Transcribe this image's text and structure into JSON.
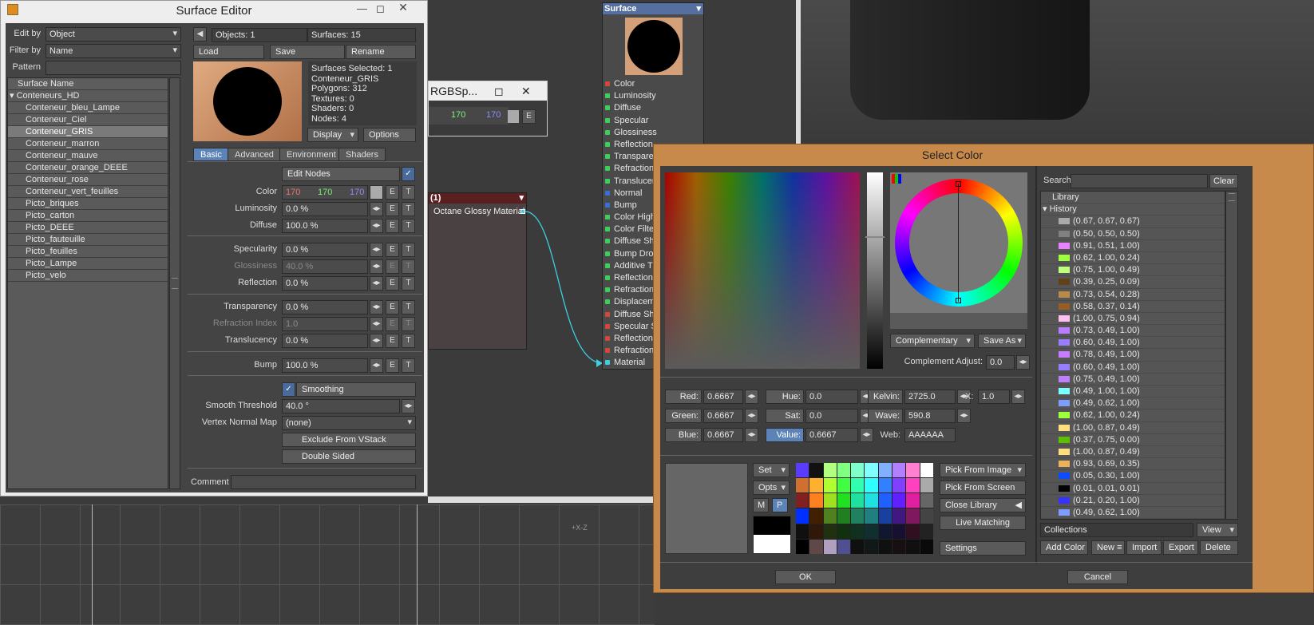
{
  "surface_editor": {
    "title": "Surface Editor",
    "edit_by_label": "Edit by",
    "edit_by_value": "Object",
    "filter_by_label": "Filter by",
    "filter_by_value": "Name",
    "pattern_label": "Pattern",
    "list_header": "Surface Name",
    "group": "Conteneurs_HD",
    "surfaces": [
      "Conteneur_bleu_Lampe",
      "Conteneur_Ciel",
      "Conteneur_GRIS",
      "Conteneur_marron",
      "Conteneur_mauve",
      "Conteneur_orange_DEEE",
      "Conteneur_rose",
      "Conteneur_vert_feuilles",
      "Picto_briques",
      "Picto_carton",
      "Picto_DEEE",
      "Picto_fauteuille",
      "Picto_feuilles",
      "Picto_Lampe",
      "Picto_velo"
    ],
    "selected": "Conteneur_GRIS",
    "objects": "Objects: 1",
    "surfaces_count": "Surfaces: 15",
    "load": "Load",
    "save": "Save",
    "rename": "Rename",
    "info": [
      "Surfaces Selected: 1",
      "Conteneur_GRIS",
      "Polygons: 312",
      "Textures: 0",
      "Shaders: 0",
      "Nodes: 4"
    ],
    "display": "Display",
    "options": "Options",
    "tabs": [
      "Basic",
      "Advanced",
      "Environment",
      "Shaders"
    ],
    "edit_nodes": "Edit Nodes",
    "color_label": "Color",
    "color_r": "170",
    "color_g": "170",
    "color_b": "170",
    "luminosity_label": "Luminosity",
    "luminosity": "0.0 %",
    "diffuse_label": "Diffuse",
    "diffuse": "100.0 %",
    "specularity_label": "Specularity",
    "specularity": "0.0 %",
    "glossiness_label": "Glossiness",
    "glossiness": "40.0 %",
    "reflection_label": "Reflection",
    "reflection": "0.0 %",
    "transparency_label": "Transparency",
    "transparency": "0.0 %",
    "refraction_label": "Refraction Index",
    "refraction": "1.0",
    "translucency_label": "Translucency",
    "translucency": "0.0 %",
    "bump_label": "Bump",
    "bump": "100.0 %",
    "smoothing": "Smoothing",
    "smooth_threshold_label": "Smooth Threshold",
    "smooth_threshold": "40.0 °",
    "vertex_normal_label": "Vertex Normal Map",
    "vertex_normal": "(none)",
    "exclude_vstack": "Exclude From VStack",
    "double_sided": "Double Sided",
    "comment_label": "Comment",
    "e": "E",
    "t": "T"
  },
  "rgb_panel": {
    "title": "RGBSp...",
    "g": "170",
    "b": "170",
    "e": "E"
  },
  "node": {
    "header": "(1)",
    "output": "Octane Glossy Material"
  },
  "surface_node": {
    "title": "Surface",
    "ports": [
      {
        "name": "Color",
        "color": "#d04a3a"
      },
      {
        "name": "Luminosity",
        "color": "#3ccf5a"
      },
      {
        "name": "Diffuse",
        "color": "#3ccf5a"
      },
      {
        "name": "Specular",
        "color": "#3ccf5a"
      },
      {
        "name": "Glossiness",
        "color": "#3ccf5a"
      },
      {
        "name": "Reflection",
        "color": "#3ccf5a"
      },
      {
        "name": "Transparen",
        "color": "#3ccf5a"
      },
      {
        "name": "Refraction",
        "color": "#3ccf5a"
      },
      {
        "name": "Translucen",
        "color": "#3ccf5a"
      },
      {
        "name": "Normal",
        "color": "#3b6fd8"
      },
      {
        "name": "Bump",
        "color": "#3b6fd8"
      },
      {
        "name": "Color Highli",
        "color": "#3ccf5a"
      },
      {
        "name": "Color Filter",
        "color": "#3ccf5a"
      },
      {
        "name": "Diffuse Sha",
        "color": "#3ccf5a"
      },
      {
        "name": "Bump Drop",
        "color": "#3ccf5a"
      },
      {
        "name": "Additive Tra",
        "color": "#3ccf5a"
      },
      {
        "name": "Reflection",
        "color": "#3ccf5a"
      },
      {
        "name": "Refraction",
        "color": "#3ccf5a"
      },
      {
        "name": "Displaceme",
        "color": "#3ccf5a"
      },
      {
        "name": "Diffuse Sha",
        "color": "#d04a3a"
      },
      {
        "name": "Specular S",
        "color": "#d04a3a"
      },
      {
        "name": "Reflection",
        "color": "#d04a3a"
      },
      {
        "name": "Refraction",
        "color": "#d04a3a"
      },
      {
        "name": "Material",
        "color": "#3ad0e0"
      }
    ]
  },
  "select_color": {
    "title": "Select Color",
    "complementary": "Complementary",
    "save_as": "Save As",
    "complement_adjust_label": "Complement Adjust:",
    "complement_adjust": "0.0",
    "red_label": "Red:",
    "red": "0.6667",
    "green_label": "Green:",
    "green": "0.6667",
    "blue_label": "Blue:",
    "blue": "0.6667",
    "hue_label": "Hue:",
    "hue": "0.0",
    "sat_label": "Sat:",
    "sat": "0.0",
    "value_label": "Value:",
    "value": "0.6667",
    "kelvin_label": "Kelvin:",
    "kelvin": "2725.0",
    "wave_label": "Wave:",
    "wave": "590.8",
    "web_label": "Web:",
    "web": "AAAAAA",
    "x_label": "X:",
    "x": "1.0",
    "set": "Set",
    "opts": "Opts",
    "m": "M",
    "p": "P",
    "pick_image": "Pick From Image",
    "pick_screen": "Pick From Screen",
    "close_library": "Close Library",
    "live_matching": "Live Matching",
    "settings": "Settings",
    "search_label": "Search",
    "clear": "Clear",
    "library": "Library",
    "history": "History",
    "history_items": [
      {
        "text": "(0.67, 0.67, 0.67)",
        "color": "#aaaaaa"
      },
      {
        "text": "(0.50, 0.50, 0.50)",
        "color": "#808080"
      },
      {
        "text": "(0.91, 0.51, 1.00)",
        "color": "#e882ff"
      },
      {
        "text": "(0.62, 1.00, 0.24)",
        "color": "#9eff3d"
      },
      {
        "text": "(0.75, 1.00, 0.49)",
        "color": "#bfff7d"
      },
      {
        "text": "(0.39, 0.25, 0.09)",
        "color": "#634017"
      },
      {
        "text": "(0.73, 0.54, 0.28)",
        "color": "#ba8a47"
      },
      {
        "text": "(0.58, 0.37, 0.14)",
        "color": "#945e24"
      },
      {
        "text": "(1.00, 0.75, 0.94)",
        "color": "#ffbff0"
      },
      {
        "text": "(0.73, 0.49, 1.00)",
        "color": "#ba7dff"
      },
      {
        "text": "(0.60, 0.49, 1.00)",
        "color": "#997dff"
      },
      {
        "text": "(0.78, 0.49, 1.00)",
        "color": "#c77dff"
      },
      {
        "text": "(0.60, 0.49, 1.00)",
        "color": "#997dff"
      },
      {
        "text": "(0.75, 0.49, 1.00)",
        "color": "#bf7dff"
      },
      {
        "text": "(0.49, 1.00, 1.00)",
        "color": "#7dffff"
      },
      {
        "text": "(0.49, 0.62, 1.00)",
        "color": "#7d9eff"
      },
      {
        "text": "(0.62, 1.00, 0.24)",
        "color": "#9eff3d"
      },
      {
        "text": "(1.00, 0.87, 0.49)",
        "color": "#ffde7d"
      },
      {
        "text": "(0.37, 0.75, 0.00)",
        "color": "#5ebf00"
      },
      {
        "text": "(1.00, 0.87, 0.49)",
        "color": "#ffde7d"
      },
      {
        "text": "(0.93, 0.69, 0.35)",
        "color": "#edb059"
      },
      {
        "text": "(0.05, 0.30, 1.00)",
        "color": "#0d4dff"
      },
      {
        "text": "(0.01, 0.01, 0.01)",
        "color": "#030303"
      },
      {
        "text": "(0.21, 0.20, 1.00)",
        "color": "#3633ff"
      },
      {
        "text": "(0.49, 0.62, 1.00)",
        "color": "#7d9eff"
      }
    ],
    "collections": "Collections",
    "view": "View",
    "add_color": "Add Color",
    "new": "New",
    "import": "Import",
    "export": "Export",
    "delete": "Delete",
    "ok": "OK",
    "cancel": "Cancel",
    "palette": [
      "#5a3cff",
      "#111111",
      "#b0ff80",
      "#80ff80",
      "#80ffcc",
      "#80ffff",
      "#80b0ff",
      "#b080ff",
      "#ff80d0",
      "#ffffff",
      "#d07030",
      "#ffb030",
      "#b0ff30",
      "#40ff40",
      "#30ffb0",
      "#30ffff",
      "#3080ff",
      "#8040ff",
      "#ff40c0",
      "#aaaaaa",
      "#802020",
      "#ff8020",
      "#a0e020",
      "#20e020",
      "#20e0a0",
      "#20e0e0",
      "#2060ff",
      "#6020ff",
      "#e020a0",
      "#666666",
      "#0030ff",
      "#402000",
      "#508020",
      "#208020",
      "#208060",
      "#208080",
      "#1840a0",
      "#401880",
      "#801860",
      "#444444",
      "#101010",
      "#301808",
      "#203010",
      "#103010",
      "#103020",
      "#103030",
      "#101830",
      "#181030",
      "#301020",
      "#222222",
      "#000000",
      "#604848",
      "#b0a0c0",
      "#505090",
      "#101010",
      "#101818",
      "#101010",
      "#181010",
      "#101010",
      "#0a0a0a"
    ]
  },
  "viewport": {
    "axis": "+X-Z"
  }
}
